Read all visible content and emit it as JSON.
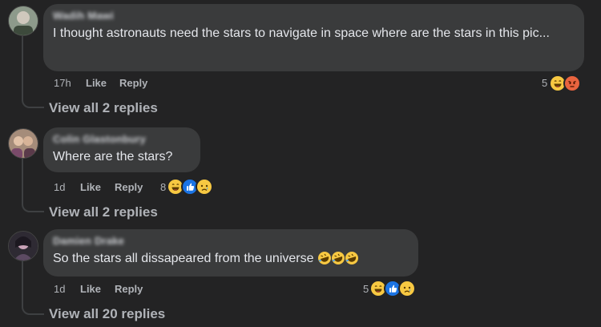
{
  "comments": [
    {
      "author": "Wadih Mawi",
      "text": "I thought astronauts need the stars to navigate in space where are the stars in this pic...",
      "time": "17h",
      "like_label": "Like",
      "reply_label": "Reply",
      "reaction_count": "5",
      "reactions": [
        "haha-emoji-icon",
        "angry-emoji-icon"
      ],
      "view_replies": "View all 2 replies"
    },
    {
      "author": "Colin Glastonbury",
      "text": "Where are the stars?",
      "time": "1d",
      "like_label": "Like",
      "reply_label": "Reply",
      "reaction_count": "8",
      "reactions": [
        "haha-emoji-icon",
        "like-icon",
        "sad-emoji-icon"
      ],
      "view_replies": "View all 2 replies"
    },
    {
      "author": "Damien Drake",
      "text": "So the stars all dissapeared from the universe",
      "text_emojis": [
        "rofl-emoji-icon",
        "rofl-emoji-icon",
        "rofl-emoji-icon"
      ],
      "time": "1d",
      "like_label": "Like",
      "reply_label": "Reply",
      "reaction_count": "5",
      "reactions": [
        "haha-emoji-icon",
        "like-icon",
        "sad-emoji-icon"
      ],
      "view_replies": "View all 20 replies"
    }
  ],
  "colors": {
    "background": "#232324",
    "bubble": "#3a3b3c",
    "text": "#e4e6eb",
    "secondary": "#b0b3b8"
  }
}
